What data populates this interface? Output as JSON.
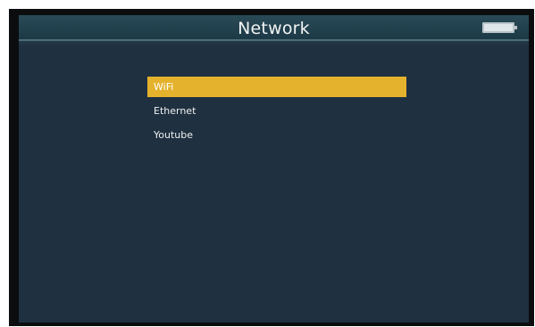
{
  "header": {
    "title": "Network"
  },
  "status": {
    "battery_icon": "battery-icon"
  },
  "menu": {
    "items": [
      {
        "label": "WiFi",
        "selected": true
      },
      {
        "label": "Ethernet",
        "selected": false
      },
      {
        "label": "Youtube",
        "selected": false
      }
    ]
  },
  "colors": {
    "background": "#1f3040",
    "header": "#1c3946",
    "highlight": "#e4b22d",
    "text": "#eef1f1"
  }
}
